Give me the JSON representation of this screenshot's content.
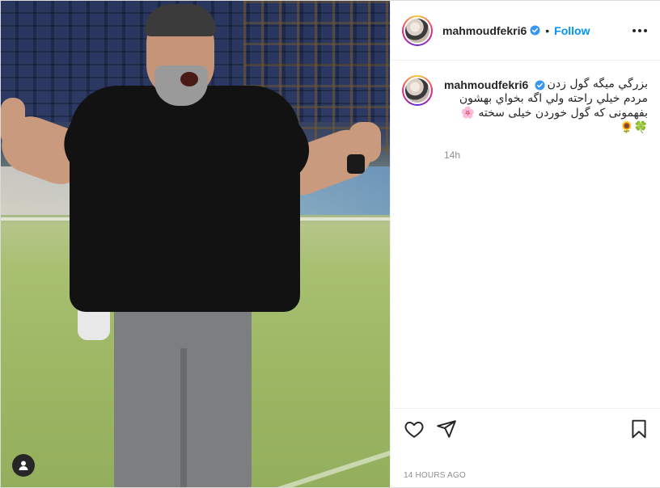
{
  "post": {
    "author": {
      "username": "mahmoudfekri6",
      "verified_icon": "verified-badge-icon",
      "separator": "•",
      "follow_label": "Follow"
    },
    "caption": {
      "username": "mahmoudfekri6",
      "text": "بزرگي ميگه گول زدن\nمردم خيلي راحته ولي اگه بخواي بهشون\nبفهمونی که گول خوردن خیلی سخته 🌸\n🍀🌻",
      "relative_time": "14h"
    },
    "timestamp": "14 HOURS AGO",
    "colors": {
      "accent": "#0095f6",
      "text": "#262626",
      "muted": "#8e8e8e",
      "border": "#efefef"
    },
    "icons": {
      "more": "more-options-icon",
      "like": "heart-icon",
      "share": "paper-plane-icon",
      "save": "bookmark-icon",
      "tag": "user-tag-icon"
    }
  }
}
